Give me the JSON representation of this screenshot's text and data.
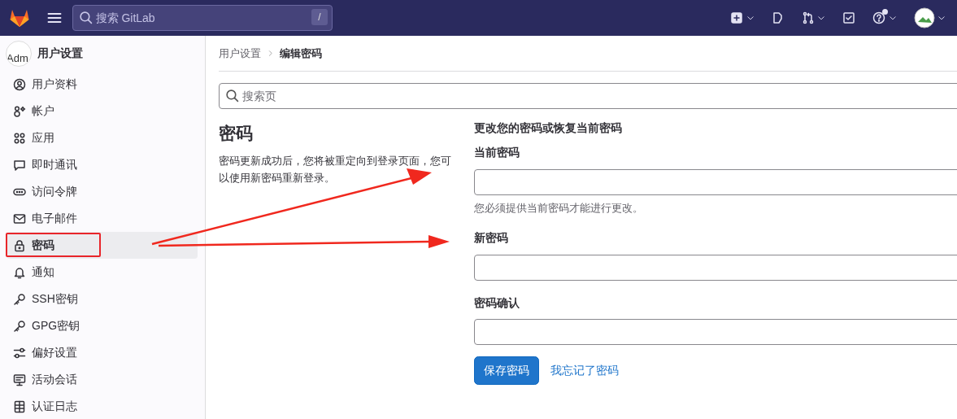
{
  "topbar": {
    "search_placeholder": "搜索 GitLab",
    "shortcut_key": "/",
    "help_badge": true
  },
  "sidebar": {
    "title": "用户设置",
    "avatar_alt": "Adm",
    "items": [
      {
        "label": "用户资料",
        "kind": "profile",
        "selected": false,
        "highlighted": false
      },
      {
        "label": "帐户",
        "kind": "account",
        "selected": false,
        "highlighted": false
      },
      {
        "label": "应用",
        "kind": "apps",
        "selected": false,
        "highlighted": false
      },
      {
        "label": "即时通讯",
        "kind": "chat",
        "selected": false,
        "highlighted": false
      },
      {
        "label": "访问令牌",
        "kind": "token",
        "selected": false,
        "highlighted": false
      },
      {
        "label": "电子邮件",
        "kind": "mail",
        "selected": false,
        "highlighted": false
      },
      {
        "label": "密码",
        "kind": "lock",
        "selected": true,
        "highlighted": true
      },
      {
        "label": "通知",
        "kind": "bell",
        "selected": false,
        "highlighted": false
      },
      {
        "label": "SSH密钥",
        "kind": "key",
        "selected": false,
        "highlighted": false
      },
      {
        "label": "GPG密钥",
        "kind": "key",
        "selected": false,
        "highlighted": false
      },
      {
        "label": "偏好设置",
        "kind": "prefs",
        "selected": false,
        "highlighted": false
      },
      {
        "label": "活动会话",
        "kind": "monitor",
        "selected": false,
        "highlighted": false
      },
      {
        "label": "认证日志",
        "kind": "log",
        "selected": false,
        "highlighted": false
      }
    ]
  },
  "breadcrumb": [
    {
      "label": "用户设置",
      "current": false
    },
    {
      "label": "编辑密码",
      "current": true
    }
  ],
  "page_search": {
    "placeholder": "搜索页"
  },
  "section": {
    "title": "密码",
    "description": "密码更新成功后，您将被重定向到登录页面，您可以使用新密码重新登录。"
  },
  "form": {
    "heading": "更改您的密码或恢复当前密码",
    "fields": [
      {
        "label": "当前密码",
        "help": "您必须提供当前密码才能进行更改。"
      },
      {
        "label": "新密码"
      },
      {
        "label": "密码确认"
      }
    ],
    "submit": "保存密码",
    "forgot_link": "我忘记了密码"
  }
}
